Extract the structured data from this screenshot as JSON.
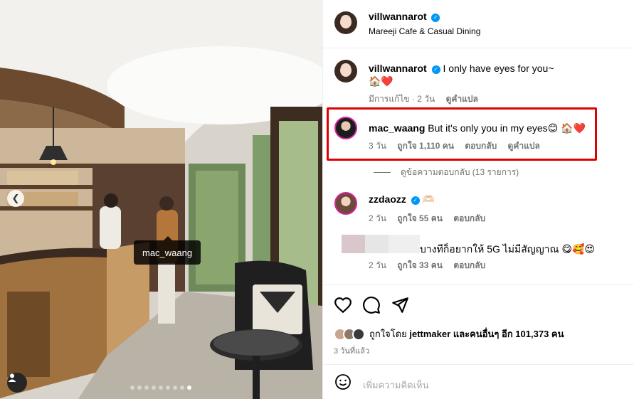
{
  "post": {
    "author": "villwannarot",
    "location": "Mareeji Cafe & Casual Dining",
    "tagged_user": "mac_waang",
    "carousel": {
      "count": 9,
      "active_index": 8
    }
  },
  "icons": {
    "verified": "verified-badge-icon",
    "prev": "chevron-left-icon",
    "user_tag": "person-icon",
    "like": "heart-icon",
    "comment": "comment-bubble-icon",
    "share": "paper-plane-icon",
    "emoji": "smiley-icon"
  },
  "comments": [
    {
      "user": "villwannarot",
      "text": "I only have eyes for you~",
      "emoji_line": "🏠❤️",
      "edited": "มีการแก้ไข · 2 วัน",
      "translate": "ดูคำแปล"
    },
    {
      "user": "mac_waang",
      "text": "But it's only you in my eyes😊 🏠❤️",
      "age": "3 วัน",
      "likes": "ถูกใจ 1,110 คน",
      "reply": "ตอบกลับ",
      "translate": "ดูคำแปล",
      "highlighted": true,
      "view_replies": "ดูข้อความตอบกลับ (13 รายการ)"
    },
    {
      "user": "zzdaozz",
      "text": "🫶🏻",
      "age": "2 วัน",
      "likes": "ถูกใจ 55 คน",
      "reply": "ตอบกลับ"
    },
    {
      "user": "",
      "text": "บางทีก็อยากให้ 5G ไม่มีสัญญาณ 😋🥰😍",
      "age": "2 วัน",
      "likes": "ถูกใจ 33 คน",
      "reply": "ตอบกลับ"
    }
  ],
  "likes_summary": {
    "prefix": "ถูกใจโดย",
    "user": "jettmaker",
    "suffix": "และคนอื่นๆ อีก 101,373 คน"
  },
  "posted": "3 วันที่แล้ว",
  "comment_input": {
    "placeholder": "เพิ่มความคิดเห็น"
  },
  "colors": {
    "highlight": "#e00000",
    "verified": "#0095f6",
    "muted": "#737373"
  }
}
